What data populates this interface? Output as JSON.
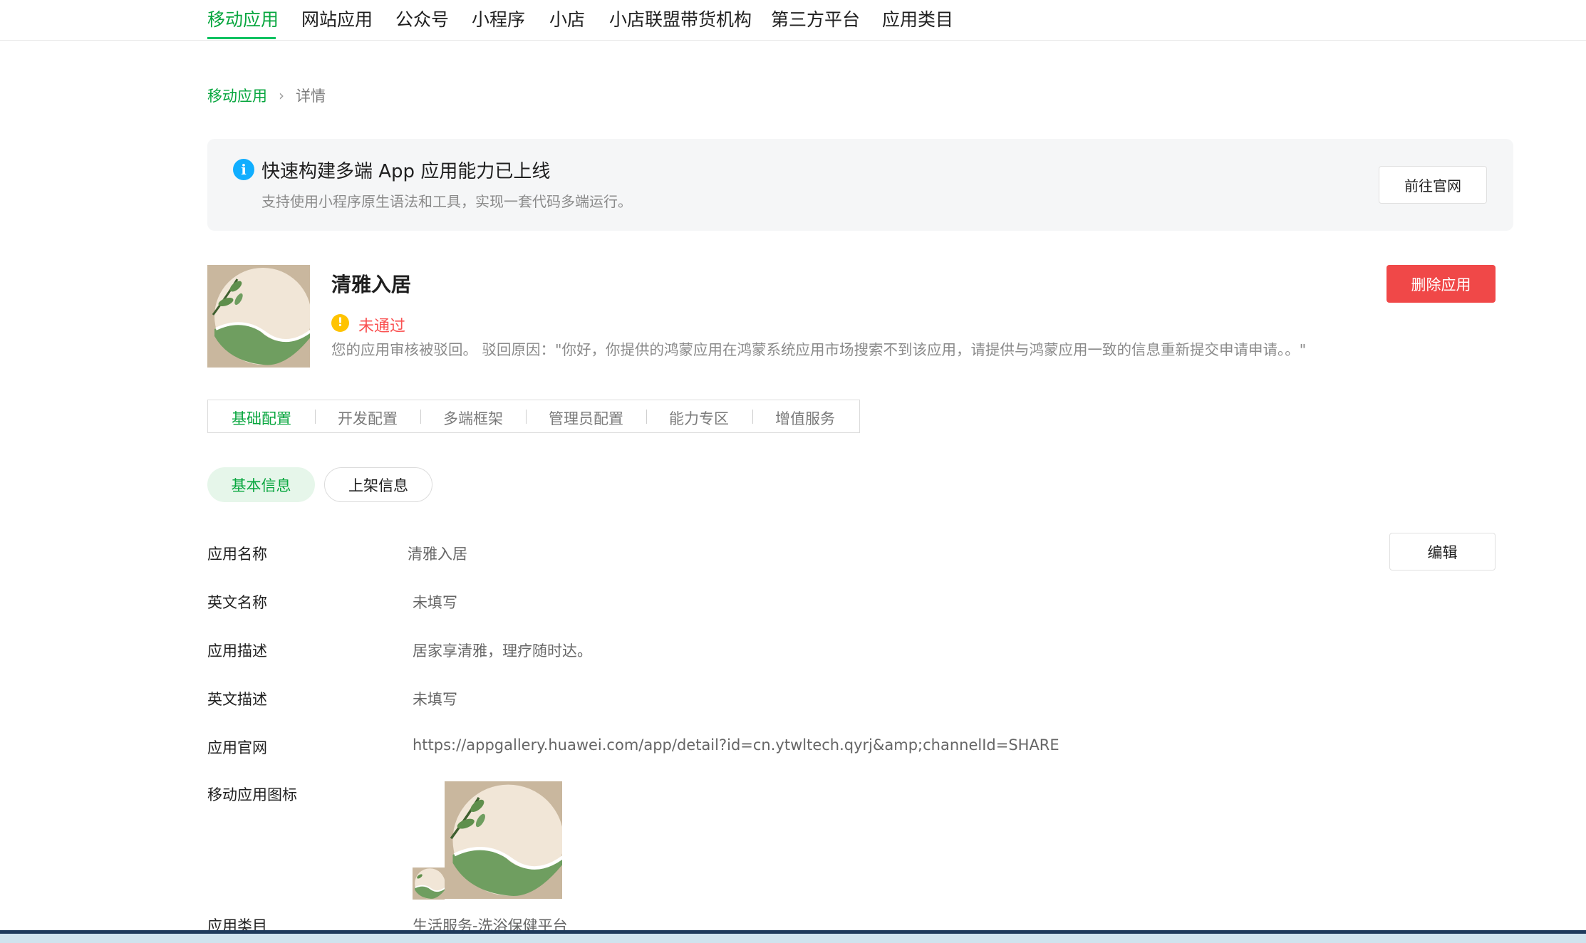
{
  "nav": {
    "tabs": [
      "移动应用",
      "网站应用",
      "公众号",
      "小程序",
      "小店",
      "小店联盟带货机构",
      "第三方平台",
      "应用类目"
    ],
    "active_index": 0
  },
  "breadcrumb": {
    "parent": "移动应用",
    "separator": "›",
    "current": "详情"
  },
  "banner": {
    "icon": "info-icon",
    "title": "快速构建多端 App 应用能力已上线",
    "desc": "支持使用小程序原生语法和工具，实现一套代码多端运行。",
    "button": "前往官网"
  },
  "app": {
    "name": "清雅入居",
    "status": "未通过",
    "status_icon": "warning-icon",
    "reject_message": "您的应用审核被驳回。 驳回原因：\"你好，你提供的鸿蒙应用在鸿蒙系统应用市场搜索不到该应用，请提供与鸿蒙应用一致的信息重新提交申请申请。。\"",
    "delete_button": "删除应用"
  },
  "config_tabs": [
    "基础配置",
    "开发配置",
    "多端框架",
    "管理员配置",
    "能力专区",
    "增值服务"
  ],
  "pills": [
    "基本信息",
    "上架信息"
  ],
  "info": {
    "edit_button": "编辑",
    "rows": [
      {
        "label": "应用名称",
        "value": "清雅入居"
      },
      {
        "label": "英文名称",
        "value": "未填写"
      },
      {
        "label": "应用描述",
        "value": "居家享清雅，理疗随时达。"
      },
      {
        "label": "英文描述",
        "value": "未填写"
      },
      {
        "label": "应用官网",
        "value": "https://appgallery.huawei.com/app/detail?id=cn.ytwltech.qyrj&amp;channelId=SHARE"
      },
      {
        "label": "移动应用图标",
        "value": ""
      },
      {
        "label": "应用类目",
        "value": "生活服务-洗浴保健平台"
      }
    ]
  },
  "colors": {
    "accent": "#07c160",
    "accent_text": "#07a63e",
    "danger": "#f04848",
    "warning": "#ffc300",
    "info": "#10aeff"
  }
}
